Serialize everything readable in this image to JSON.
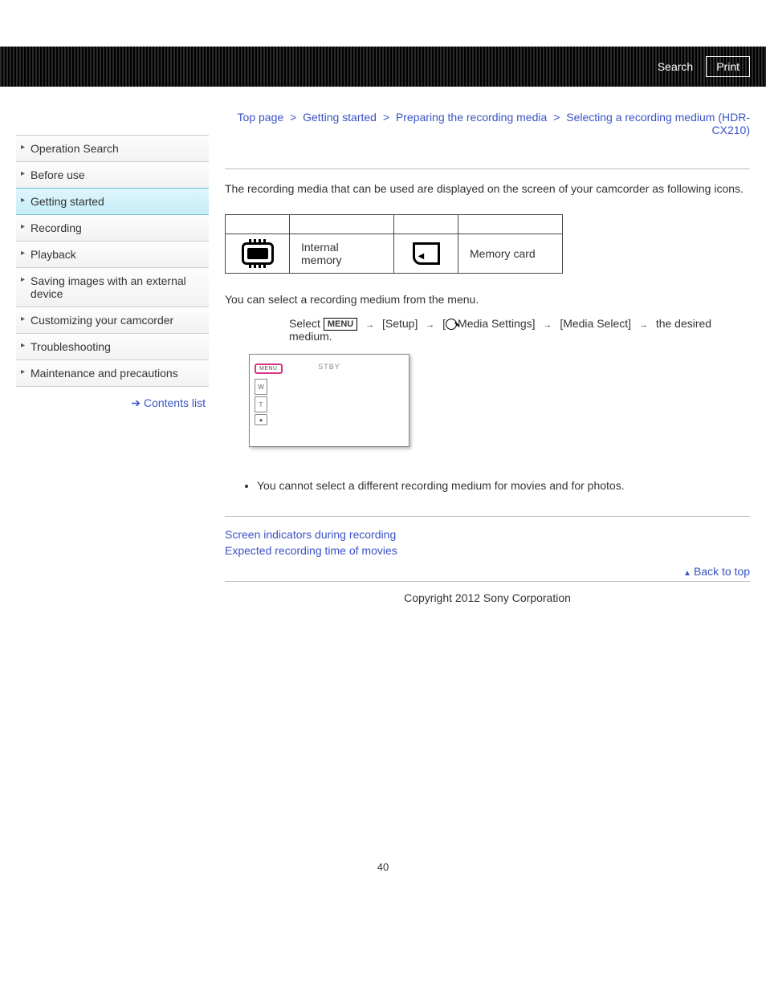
{
  "topbar": {
    "search_label": "Search",
    "print_label": "Print"
  },
  "breadcrumb": {
    "items": [
      "Top page",
      "Getting started",
      "Preparing the recording media",
      "Selecting a recording medium (HDR-CX210)"
    ],
    "sep": ">"
  },
  "sidebar": {
    "items": [
      "Operation Search",
      "Before use",
      "Getting started",
      "Recording",
      "Playback",
      "Saving images with an external device",
      "Customizing your camcorder",
      "Troubleshooting",
      "Maintenance and precautions"
    ],
    "active_index": 2,
    "contents_link": "Contents list"
  },
  "main": {
    "intro": "The recording media that can be used are displayed on the screen of your camcorder as following icons.",
    "media_table": {
      "row": [
        {
          "label": "Internal memory"
        },
        {
          "label": "Memory card"
        }
      ]
    },
    "select_line": "You can select a recording medium from the menu.",
    "step": {
      "prefix": "Select",
      "menu_badge": "MENU",
      "parts": [
        "[Setup]",
        "[",
        "Media Settings]",
        "[Media Select]",
        "the desired medium."
      ]
    },
    "screenshot": {
      "menu_text": "MENU",
      "stby": "STBY",
      "zoom": [
        "W",
        "T",
        "●"
      ]
    },
    "notes_heading": "",
    "notes": [
      "You cannot select a different recording medium for movies and for photos."
    ],
    "related": [
      "Screen indicators during recording",
      "Expected recording time of movies"
    ],
    "back_to_top": "Back to top",
    "copyright": "Copyright 2012 Sony Corporation",
    "page_number": "40"
  }
}
